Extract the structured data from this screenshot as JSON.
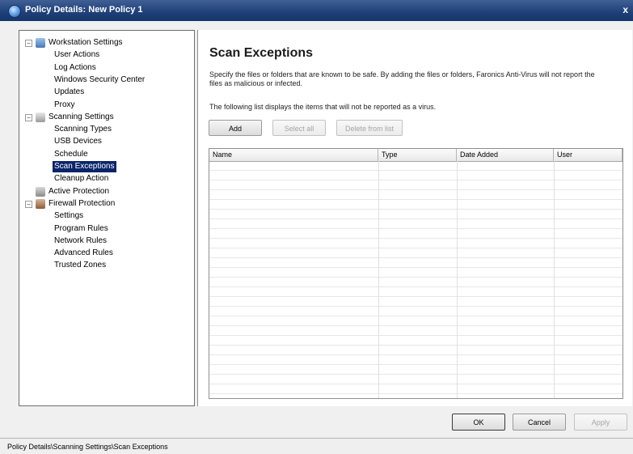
{
  "window": {
    "title": "Policy Details: New Policy 1",
    "close_glyph": "x"
  },
  "tree": {
    "items": [
      {
        "label": "Workstation Settings",
        "level": 0,
        "expander": "−",
        "icon": "workstation-icon"
      },
      {
        "label": "User Actions",
        "level": 1
      },
      {
        "label": "Log Actions",
        "level": 1
      },
      {
        "label": "Windows Security Center",
        "level": 1
      },
      {
        "label": "Updates",
        "level": 1
      },
      {
        "label": "Proxy",
        "level": 1
      },
      {
        "label": "Scanning Settings",
        "level": 0,
        "expander": "−",
        "icon": "scanning-icon"
      },
      {
        "label": "Scanning Types",
        "level": 1
      },
      {
        "label": "USB Devices",
        "level": 1
      },
      {
        "label": "Schedule",
        "level": 1
      },
      {
        "label": "Scan Exceptions",
        "level": 1,
        "selected": true
      },
      {
        "label": "Cleanup Action",
        "level": 1
      },
      {
        "label": "Active Protection",
        "level": 0,
        "icon": "active-protection-icon"
      },
      {
        "label": "Firewall Protection",
        "level": 0,
        "expander": "−",
        "icon": "firewall-icon"
      },
      {
        "label": "Settings",
        "level": 1
      },
      {
        "label": "Program Rules",
        "level": 1
      },
      {
        "label": "Network Rules",
        "level": 1
      },
      {
        "label": "Advanced Rules",
        "level": 1
      },
      {
        "label": "Trusted Zones",
        "level": 1
      }
    ]
  },
  "content": {
    "title": "Scan Exceptions",
    "description": "Specify the files or folders that are known to be safe. By adding the files or folders, Faronics Anti-Virus will not report the files as malicious or infected.",
    "list_note": "The following list displays the items that will not be reported as a virus.",
    "buttons": {
      "add": "Add",
      "select_all": "Select all",
      "delete": "Delete from list"
    },
    "grid_columns": [
      "Name",
      "Type",
      "Date Added",
      "User"
    ]
  },
  "footer": {
    "ok": "OK",
    "cancel": "Cancel",
    "apply": "Apply"
  },
  "status_bar": {
    "text": "Policy Details\\Scanning Settings\\Scan Exceptions"
  }
}
